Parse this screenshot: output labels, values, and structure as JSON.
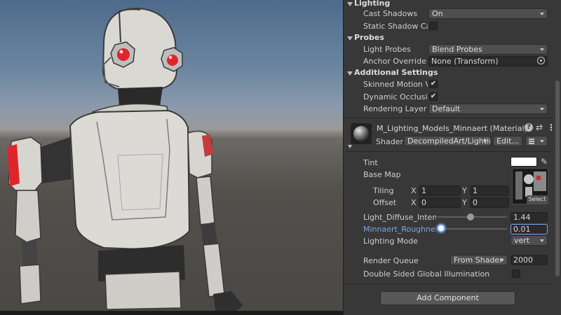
{
  "lighting": {
    "header": "Lighting",
    "cast_shadows_label": "Cast Shadows",
    "cast_shadows_value": "On",
    "static_shadow_label": "Static Shadow Cas"
  },
  "probes": {
    "header": "Probes",
    "light_probes_label": "Light Probes",
    "light_probes_value": "Blend Probes",
    "anchor_override_label": "Anchor Override",
    "anchor_override_value": "None (Transform)"
  },
  "additional": {
    "header": "Additional Settings",
    "skinned_motion_label": "Skinned Motion Ve",
    "dynamic_occlusion_label": "Dynamic Occlusion",
    "rendering_layer_label": "Rendering Layer M",
    "rendering_layer_value": "Default"
  },
  "material": {
    "name": "M_Lighting_Models_Minnaert (Material)",
    "shader_label": "Shader",
    "shader_value": "DecompiledArt/Lightin",
    "edit_label": "Edit..."
  },
  "props": {
    "tint_label": "Tint",
    "base_map_label": "Base Map",
    "select_label": "Select",
    "tiling_label": "Tiling",
    "tiling_x_axis": "X",
    "tiling_x": "1",
    "tiling_y_axis": "Y",
    "tiling_y": "1",
    "offset_label": "Offset",
    "offset_x_axis": "X",
    "offset_x": "0",
    "offset_y_axis": "Y",
    "offset_y": "0",
    "diffuse_label": "Light_Diffuse_Intensit",
    "diffuse_value": "1.44",
    "roughness_label": "Minnaert_Roughness",
    "roughness_value": "0.01",
    "lighting_mode_label": "Lighting Mode",
    "lighting_mode_value": "vert",
    "render_queue_label": "Render Queue",
    "render_queue_source": "From Shader",
    "render_queue_value": "2000",
    "dsgi_label": "Double Sided Global Illumination"
  },
  "add_component_label": "Add Component",
  "icons": {
    "foldout": "triangle-down-icon",
    "check": "checkmark-icon",
    "target": "object-picker-icon",
    "help": "help-icon",
    "settings": "preset-sliders-icon",
    "menu": "kebab-menu-icon",
    "eyedropper": "eyedropper-icon",
    "list": "list-icon"
  },
  "colors": {
    "accent_blue": "#7aa6e8",
    "robot_eye": "#e0242c",
    "robot_body": "#dcdad5",
    "inspector_bg": "#383838"
  }
}
